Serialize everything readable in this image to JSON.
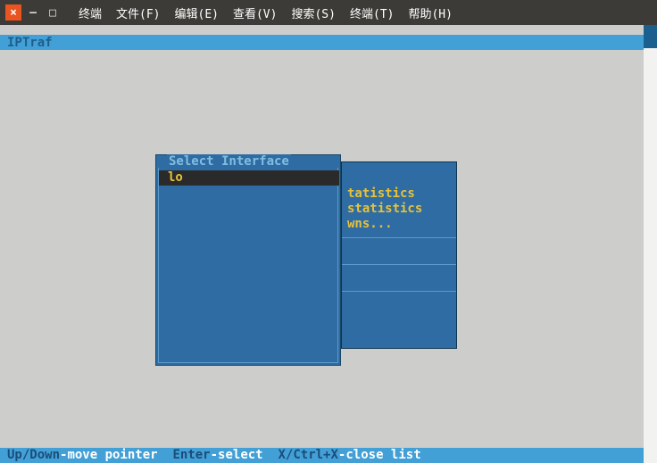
{
  "chrome": {
    "menus": [
      "终端",
      "文件(F)",
      "编辑(E)",
      "查看(V)",
      "搜索(S)",
      "终端(T)",
      "帮助(H)"
    ]
  },
  "app": {
    "title": "IPTraf"
  },
  "select_panel": {
    "title": "Select Interface",
    "items": [
      "lo"
    ],
    "selected_index": 0
  },
  "bg_panel": {
    "rows": [
      "tatistics",
      "statistics",
      "wns..."
    ]
  },
  "status": {
    "k1": "Up/Down",
    "a1": "-move pointer",
    "k2": "Enter",
    "a2": "-select",
    "k3": "X/Ctrl+X",
    "a3": "-close list"
  }
}
